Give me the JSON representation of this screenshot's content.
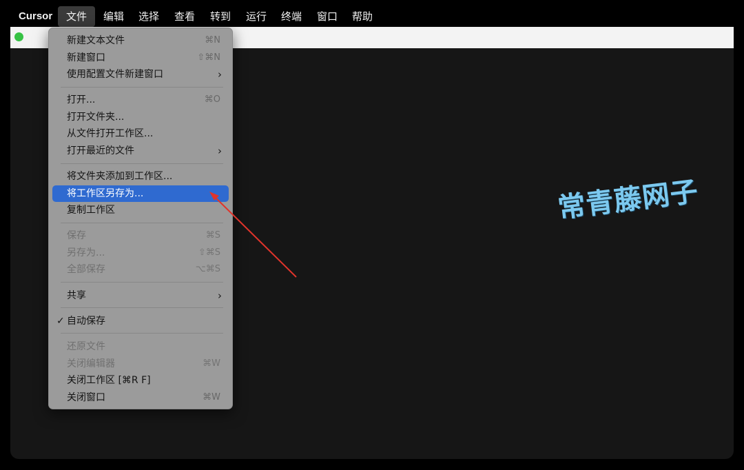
{
  "menubar": {
    "app_name": "Cursor",
    "items": [
      "文件",
      "编辑",
      "选择",
      "查看",
      "转到",
      "运行",
      "终端",
      "窗口",
      "帮助"
    ]
  },
  "file_menu": {
    "new_text_file": {
      "label": "新建文本文件",
      "shortcut": "⌘N"
    },
    "new_window": {
      "label": "新建窗口",
      "shortcut": "⇧⌘N"
    },
    "new_window_with_profile": {
      "label": "使用配置文件新建窗口"
    },
    "open": {
      "label": "打开...",
      "shortcut": "⌘O"
    },
    "open_folder": {
      "label": "打开文件夹..."
    },
    "open_workspace_from_file": {
      "label": "从文件打开工作区..."
    },
    "open_recent": {
      "label": "打开最近的文件"
    },
    "add_folder_to_workspace": {
      "label": "将文件夹添加到工作区..."
    },
    "save_workspace_as": {
      "label": "将工作区另存为..."
    },
    "duplicate_workspace": {
      "label": "复制工作区"
    },
    "save": {
      "label": "保存",
      "shortcut": "⌘S"
    },
    "save_as": {
      "label": "另存为...",
      "shortcut": "⇧⌘S"
    },
    "save_all": {
      "label": "全部保存",
      "shortcut": "⌥⌘S"
    },
    "share": {
      "label": "共享"
    },
    "auto_save": {
      "label": "自动保存",
      "checked": true
    },
    "revert_file": {
      "label": "还原文件"
    },
    "close_editor": {
      "label": "关闭编辑器",
      "shortcut": "⌘W"
    },
    "close_workspace": {
      "label": "关闭工作区 [⌘R F]"
    },
    "close_window": {
      "label": "关闭窗口",
      "shortcut": "⌘W"
    }
  },
  "watermark": {
    "text": "常青藤网子"
  },
  "colors": {
    "highlight": "#2f6ad0",
    "menu_bg": "#9b9b9b",
    "editor_bg": "#161616",
    "arrow": "#e0342b",
    "watermark": "#7cc9ef"
  }
}
